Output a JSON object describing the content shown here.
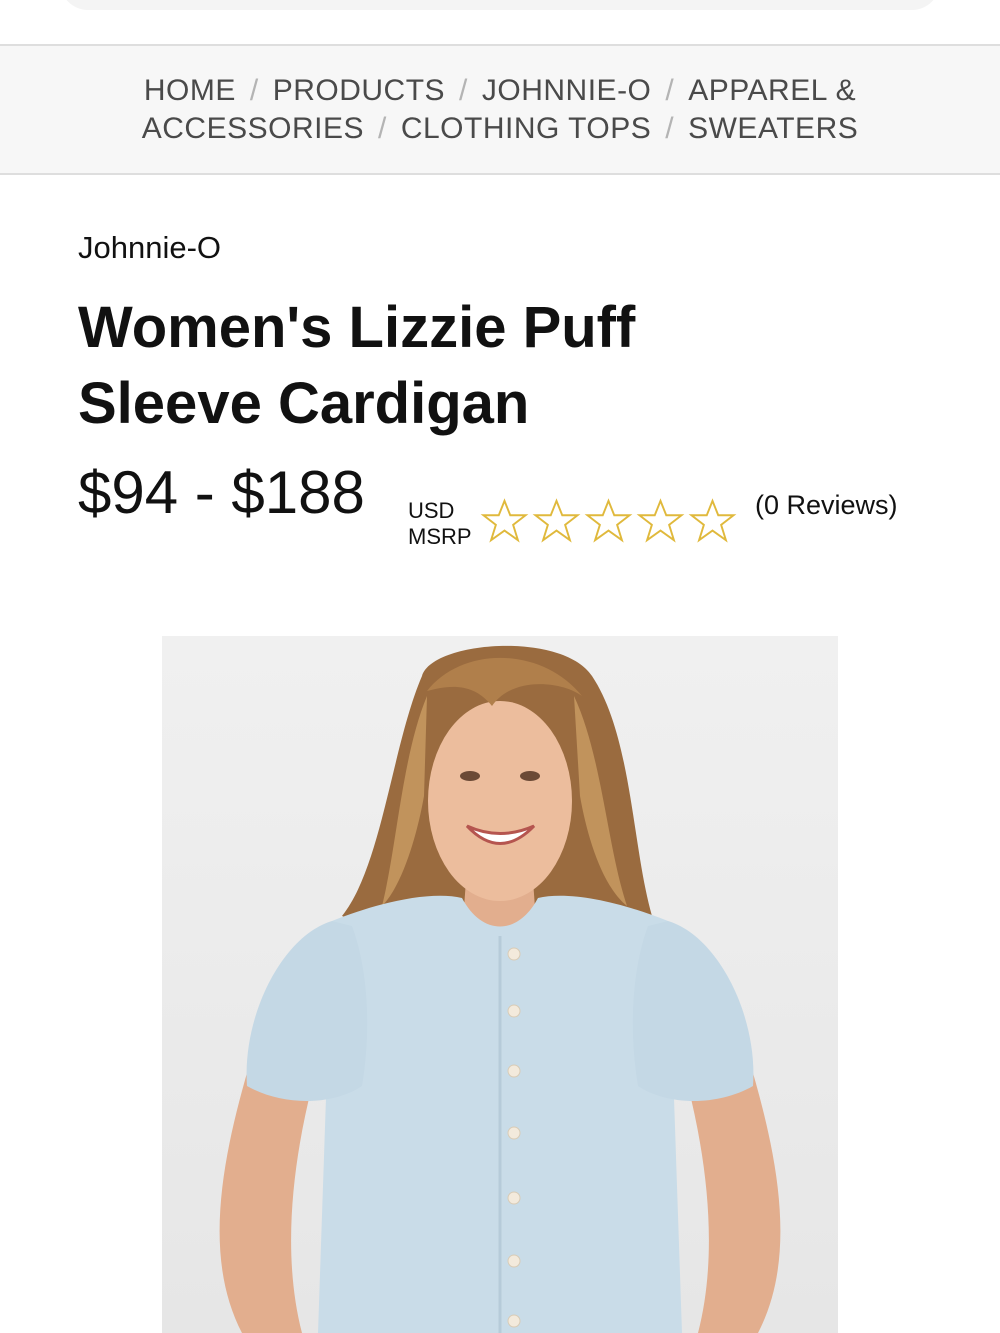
{
  "breadcrumb": {
    "items": [
      "HOME",
      "PRODUCTS",
      "JOHNNIE-O",
      "APPAREL & ACCESSORIES",
      "CLOTHING TOPS",
      "SWEATERS"
    ],
    "separator": "/"
  },
  "product": {
    "brand": "Johnnie-O",
    "title": "Women's Lizzie Puff Sleeve Cardigan",
    "price_range": "$94 - $188",
    "currency_line1": "USD",
    "currency_line2": "MSRP",
    "rating": 0,
    "rating_max": 5,
    "reviews_label": "(0 Reviews)",
    "image_icon": "product-photo"
  },
  "colors": {
    "star": "#e0b93c",
    "breadcrumb_bg": "#f7f7f7",
    "cardigan": "#c9dce8"
  }
}
